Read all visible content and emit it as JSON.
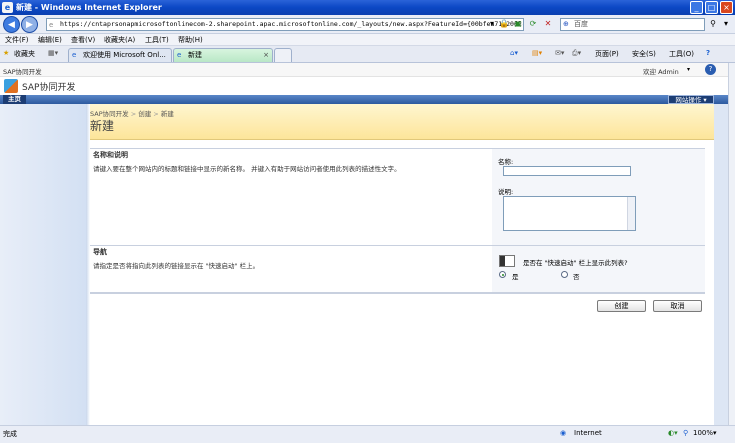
{
  "window": {
    "title": "新建 - Windows Internet Explorer"
  },
  "address": {
    "url": "https://cntaprsonapmicrosoftonlinecom-2.sharepoint.apac.microsoftonline.com/_layouts/new.aspx?FeatureId={00bfea71-2062-4",
    "search_placeholder": "百度"
  },
  "menu": [
    "文件(F)",
    "编辑(E)",
    "查看(V)",
    "收藏夹(A)",
    "工具(T)",
    "帮助(H)"
  ],
  "favorites_label": "收藏夹",
  "tabs": [
    {
      "label": "欢迎使用 Microsoft Onl..."
    },
    {
      "label": "新建"
    }
  ],
  "command_bar": {
    "page": "页面(P)",
    "safety": "安全(S)",
    "tools": "工具(O)",
    "help": "?"
  },
  "sharepoint": {
    "site_crumb": "SAP协同开发",
    "welcome": "欢迎 Admin",
    "site_title": "SAP协同开发",
    "home_tab": "主页",
    "site_actions": "网站操作",
    "breadcrumb": [
      "SAP协同开发",
      "创建",
      "新建"
    ],
    "page_title": "新建"
  },
  "form": {
    "name_section": {
      "heading": "名称和说明",
      "description": "请键入要在整个网站内的标题和链接中显示的新名称。 并键入有助于网站访问者使用此列表的描述性文字。",
      "name_label": "名称:",
      "description_label": "说明:"
    },
    "nav_section": {
      "heading": "导航",
      "description": "请指定是否将指向此列表的链接显示在 \"快速启动\" 栏上。",
      "question": "是否在 \"快速启动\" 栏上显示此列表?",
      "yes": "是",
      "no": "否"
    },
    "create_button": "创建",
    "cancel_button": "取消"
  },
  "status": {
    "left": "完成",
    "zone": "Internet",
    "zoom": "100%"
  }
}
